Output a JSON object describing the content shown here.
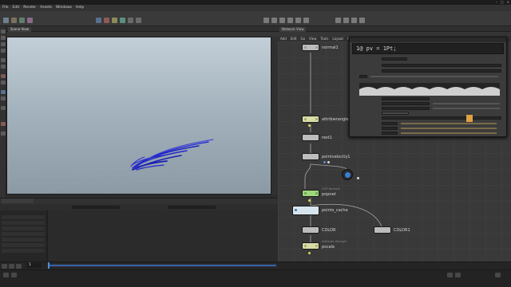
{
  "window": {
    "controls": [
      "–",
      "□",
      "✕"
    ]
  },
  "menubar": {
    "items": [
      "File",
      "Edit",
      "Render",
      "Assets",
      "Windows",
      "Help"
    ]
  },
  "viewport": {
    "tab_label": "Scene View"
  },
  "network": {
    "tab_label": "Network View",
    "menu": [
      "Add",
      "Edit",
      "Go",
      "View",
      "Tools",
      "Layout",
      "Help"
    ]
  },
  "nodes": [
    {
      "name": "normal1",
      "sub": "",
      "color": "#bcbcbc"
    },
    {
      "name": "attribwrangle1",
      "sub": "",
      "color": "#d9dca6"
    },
    {
      "name": "rest1",
      "sub": "",
      "color": "#bcbcbc"
    },
    {
      "name": "pointvelocity1",
      "sub": "",
      "color": "#bcbcbc"
    },
    {
      "name": "popnet",
      "sub": "DOP Network",
      "color": "#9fd67e"
    },
    {
      "name": "points_cache",
      "sub": "",
      "color": "#d6e4ee"
    },
    {
      "name": "COLOR",
      "sub": "",
      "color": "#bcbcbc"
    },
    {
      "name": "COLOR1",
      "sub": "",
      "color": "#bcbcbc"
    },
    {
      "name": "pscale",
      "sub": "Attribute Wrangle",
      "color": "#d9dca6"
    }
  ],
  "param_editor": {
    "code": "1@ pv = 1Pt;"
  },
  "timeline": {
    "current_frame": "1"
  },
  "colors": {
    "accent_blue": "#375ea3",
    "node_yellow": "#d9dca6",
    "node_green": "#9fd67e",
    "ramp_orange": "#e0a043"
  }
}
